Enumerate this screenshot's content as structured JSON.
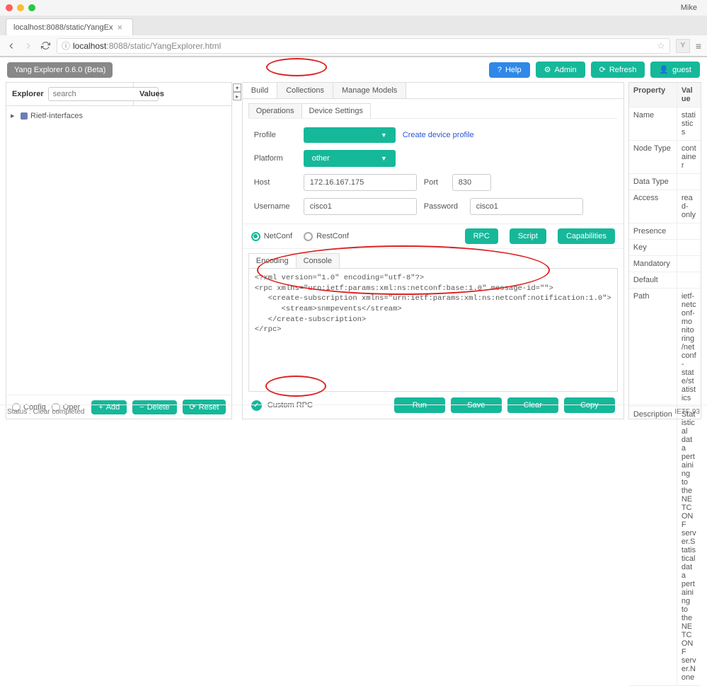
{
  "browser": {
    "user": "Mike",
    "tab_title": "localhost:8088/static/YangEx",
    "url_host": "localhost",
    "url_port": ":8088",
    "url_path": "/static/YangExplorer.html"
  },
  "topbar": {
    "version_badge": "Yang Explorer 0.6.0 (Beta)",
    "help": "Help",
    "admin": "Admin",
    "refresh": "Refresh",
    "guest": "guest"
  },
  "explorer": {
    "title": "Explorer",
    "search_placeholder": "search",
    "values_title": "Values",
    "tree_node": "Rietf-interfaces",
    "config": "Config",
    "oper": "Oper",
    "add": "Add",
    "delete": "Delete",
    "reset": "Reset"
  },
  "mid": {
    "tabs": {
      "build": "Build",
      "collections": "Collections",
      "manage": "Manage Models"
    },
    "subtabs": {
      "ops": "Operations",
      "device": "Device Settings"
    },
    "form": {
      "profile_label": "Profile",
      "create_profile": "Create device profile",
      "platform_label": "Platform",
      "platform_value": "other",
      "host_label": "Host",
      "host_value": "172.16.167.175",
      "port_label": "Port",
      "port_value": "830",
      "user_label": "Username",
      "user_value": "cisco1",
      "pass_label": "Password",
      "pass_value": "cisco1"
    },
    "proto": {
      "netconf": "NetConf",
      "restconf": "RestConf",
      "rpc": "RPC",
      "script": "Script",
      "caps": "Capabilities"
    },
    "enc": {
      "encoding": "Encoding",
      "console": "Console"
    },
    "xml": "<?xml version=\"1.0\" encoding=\"utf-8\"?>\n<rpc xmlns=\"urn:ietf:params:xml:ns:netconf:base:1.0\" message-id=\"\">\n   <create-subscription xmlns=\"urn:ietf:params:xml:ns:netconf:notification:1.0\">\n      <stream>snmpevents</stream>\n   </create-subscription>\n</rpc>",
    "custom_rpc": "Custom RPC",
    "run": "Run",
    "save": "Save",
    "clear": "Clear",
    "copy": "Copy"
  },
  "props": {
    "header_k": "Property",
    "header_v": "Value",
    "rows": [
      {
        "k": "Name",
        "v": "statistics"
      },
      {
        "k": "Node Type",
        "v": "container"
      },
      {
        "k": "Data Type",
        "v": ""
      },
      {
        "k": "Access",
        "v": "read-only"
      },
      {
        "k": "Presence",
        "v": ""
      },
      {
        "k": "Key",
        "v": ""
      },
      {
        "k": "Mandatory",
        "v": ""
      },
      {
        "k": "Default",
        "v": ""
      },
      {
        "k": "Path",
        "v": "ietf-netconf-monitoring/netconf-state/statistics"
      },
      {
        "k": "Description",
        "v": "Statistical data pertaining to the NETCONF server.Statistical data pertaining to the NETCONF server.None"
      }
    ]
  },
  "status": {
    "text": "Status : Clear completed",
    "right": "IETF 93"
  }
}
